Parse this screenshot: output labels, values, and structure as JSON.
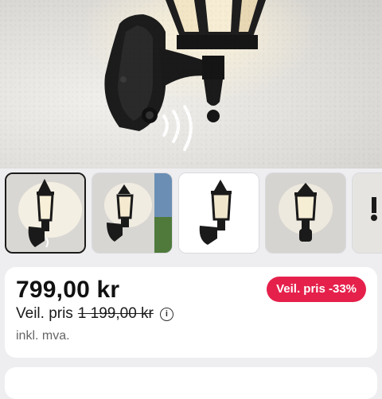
{
  "product": {
    "price": "799,00 kr",
    "reference_label": "Veil. pris",
    "reference_price": "1 199,00 kr",
    "discount_badge": "Veil. pris -33%",
    "vat_note": "inkl. mva."
  },
  "gallery": {
    "selected_index": 0,
    "thumbnails": [
      {
        "name": "lantern-night-sensor"
      },
      {
        "name": "lantern-wall-garden"
      },
      {
        "name": "lantern-white-background"
      },
      {
        "name": "lantern-front-view"
      },
      {
        "name": "lantern-partial"
      }
    ]
  },
  "colors": {
    "badge": "#e5214b",
    "page_background": "#eeeef1",
    "card": "#ffffff"
  },
  "icons": [
    "info-icon",
    "motion-sensor-waves"
  ]
}
